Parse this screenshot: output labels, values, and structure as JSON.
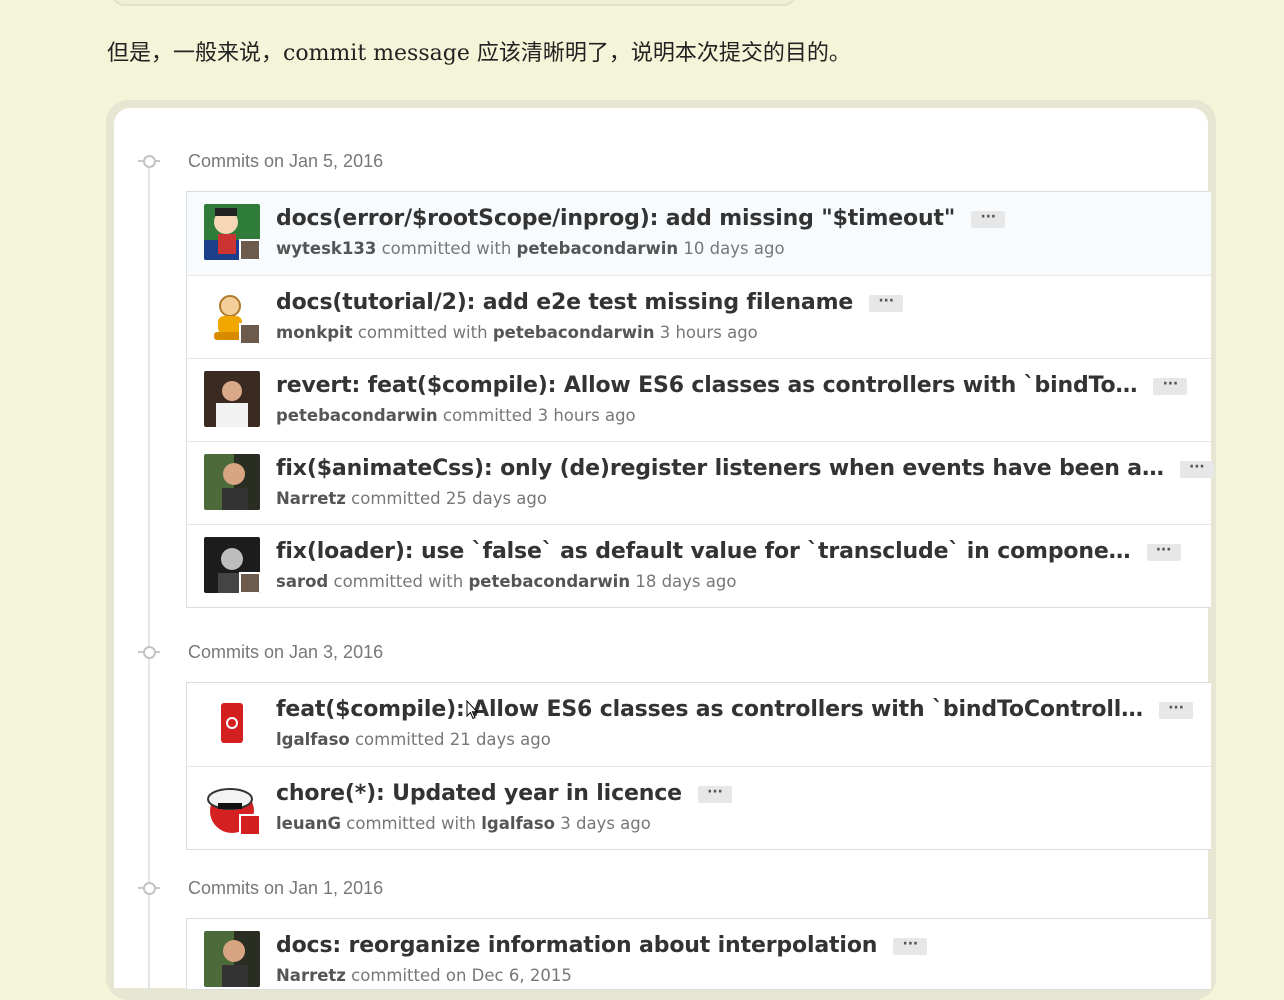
{
  "intro_text": "但是，一般来说，commit message 应该清晰明了，说明本次提交的目的。",
  "days": [
    {
      "label": "Commits on Jan 5, 2016",
      "commits": [
        {
          "message": "docs(error/$rootScope/inprog): add missing \"$timeout\"",
          "author": "wytesk133",
          "action": "committed with",
          "coauthor": "petebacondarwin",
          "time": "10 days ago",
          "ellipsis": "···"
        },
        {
          "message": "docs(tutorial/2): add e2e test missing filename",
          "author": "monkpit",
          "action": "committed with",
          "coauthor": "petebacondarwin",
          "time": "3 hours ago",
          "ellipsis": "···"
        },
        {
          "message": "revert: feat($compile): Allow ES6 classes as controllers with `bindTo…",
          "author": "petebacondarwin",
          "action": "committed",
          "coauthor": "",
          "time": "3 hours ago",
          "ellipsis": "···"
        },
        {
          "message": "fix($animateCss): only (de)register listeners when events have been a…",
          "author": "Narretz",
          "action": "committed",
          "coauthor": "",
          "time": "25 days ago",
          "ellipsis": "···"
        },
        {
          "message": "fix(loader): use `false` as default value for `transclude` in compone…",
          "author": "sarod",
          "action": "committed with",
          "coauthor": "petebacondarwin",
          "time": "18 days ago",
          "ellipsis": "···"
        }
      ]
    },
    {
      "label": "Commits on Jan 3, 2016",
      "commits": [
        {
          "message": "feat($compile): Allow ES6 classes as controllers with `bindToControll…",
          "author": "lgalfaso",
          "action": "committed",
          "coauthor": "",
          "time": "21 days ago",
          "ellipsis": "···"
        },
        {
          "message": "chore(*): Updated year in licence",
          "author": "leuanG",
          "action": "committed with",
          "coauthor": "lgalfaso",
          "time": "3 days ago",
          "ellipsis": "···"
        }
      ]
    },
    {
      "label": "Commits on Jan 1, 2016",
      "commits": [
        {
          "message": "docs: reorganize information about interpolation",
          "author": "Narretz",
          "action": "committed on Dec 6, 2015",
          "coauthor": "",
          "time": "",
          "ellipsis": "···"
        }
      ]
    }
  ],
  "colors": {
    "page_background": "#f4f4d8",
    "card_background": "#ffffff",
    "message_text": "#333333",
    "meta_text": "#777777"
  }
}
